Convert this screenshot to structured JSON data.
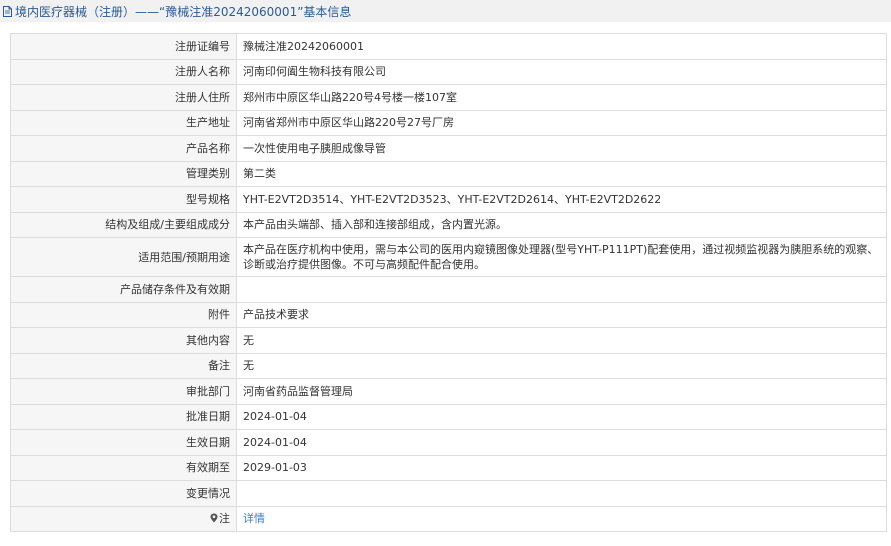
{
  "header": {
    "title": "境内医疗器械（注册）——“豫械注准20242060001”基本信息"
  },
  "rows": [
    {
      "label": "注册证编号",
      "value": "豫械注准20242060001"
    },
    {
      "label": "注册人名称",
      "value": "河南印何阖生物科技有限公司"
    },
    {
      "label": "注册人住所",
      "value": "郑州市中原区华山路220号4号楼一楼107室"
    },
    {
      "label": "生产地址",
      "value": "河南省郑州市中原区华山路220号27号厂房"
    },
    {
      "label": "产品名称",
      "value": "一次性使用电子胰胆成像导管"
    },
    {
      "label": "管理类别",
      "value": "第二类"
    },
    {
      "label": "型号规格",
      "value": "YHT-E2VT2D3514、YHT-E2VT2D3523、YHT-E2VT2D2614、YHT-E2VT2D2622"
    },
    {
      "label": "结构及组成/主要组成成分",
      "value": "本产品由头端部、插入部和连接部组成，含内置光源。"
    },
    {
      "label": "适用范围/预期用途",
      "value": "本产品在医疗机构中使用，需与本公司的医用内窥镜图像处理器(型号YHT-P111PT)配套使用，通过视频监视器为胰胆系统的观察、诊断或治疗提供图像。不可与高频配件配合使用。"
    },
    {
      "label": "产品储存条件及有效期",
      "value": ""
    },
    {
      "label": "附件",
      "value": "产品技术要求"
    },
    {
      "label": "其他内容",
      "value": "无"
    },
    {
      "label": "备注",
      "value": "无"
    },
    {
      "label": "审批部门",
      "value": "河南省药品监督管理局"
    },
    {
      "label": "批准日期",
      "value": "2024-01-04"
    },
    {
      "label": "生效日期",
      "value": "2024-01-04"
    },
    {
      "label": "有效期至",
      "value": "2029-01-03"
    },
    {
      "label": "变更情况",
      "value": ""
    }
  ],
  "note_row": {
    "label": "注",
    "link": "详情"
  },
  "colors": {
    "header_text": "#2a5a93",
    "header_bg": "#f1f1f1",
    "label_bg": "#f6f6f6",
    "border": "#dcdcdc",
    "link": "#3c7ec5"
  }
}
